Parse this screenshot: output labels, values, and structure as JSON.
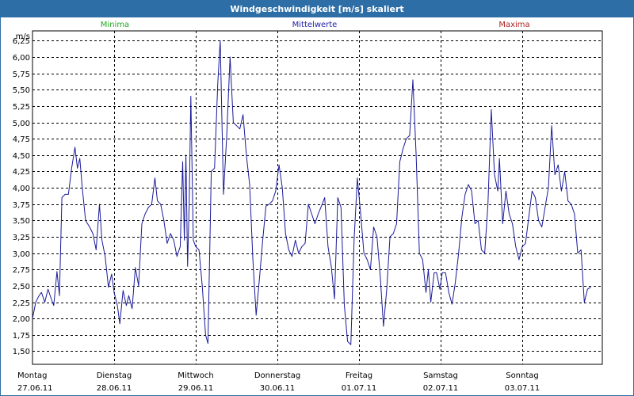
{
  "window": {
    "title": "Windgeschwindigkeit [m/s] skaliert"
  },
  "legend": [
    {
      "label": "Minima",
      "color": "#22aa22"
    },
    {
      "label": "Mittelwerte",
      "color": "#2222aa"
    },
    {
      "label": "Maxima",
      "color": "#aa2222"
    }
  ],
  "chart_data": {
    "type": "line",
    "title": "Windgeschwindigkeit [m/s] skaliert",
    "ylabel": "m/s",
    "xlabel": "",
    "ylim": [
      1.3,
      6.4
    ],
    "yticks": [
      "1,50",
      "1,75",
      "2,00",
      "2,25",
      "2,50",
      "2,75",
      "3,00",
      "3,25",
      "3,50",
      "3,75",
      "4,00",
      "4,25",
      "4,50",
      "4,75",
      "5,00",
      "5,25",
      "5,50",
      "5,75",
      "6,00",
      "6,25"
    ],
    "ytick_values": [
      1.5,
      1.75,
      2.0,
      2.25,
      2.5,
      2.75,
      3.0,
      3.25,
      3.5,
      3.75,
      4.0,
      4.25,
      4.5,
      4.75,
      5.0,
      5.25,
      5.5,
      5.75,
      6.0,
      6.25
    ],
    "xlim": [
      0,
      7
    ],
    "categories": [
      {
        "day": "Montag",
        "date": "27.06.11"
      },
      {
        "day": "Dienstag",
        "date": "28.06.11"
      },
      {
        "day": "Mittwoch",
        "date": "29.06.11"
      },
      {
        "day": "Donnerstag",
        "date": "30.06.11"
      },
      {
        "day": "Freitag",
        "date": "01.07.11"
      },
      {
        "day": "Samstag",
        "date": "02.07.11"
      },
      {
        "day": "Sonntag",
        "date": "03.07.11"
      }
    ],
    "grid": true,
    "series": [
      {
        "name": "Mittelwerte",
        "color": "#1a1a9a",
        "points": [
          [
            0.0,
            2.0
          ],
          [
            0.04,
            2.25
          ],
          [
            0.08,
            2.35
          ],
          [
            0.11,
            2.4
          ],
          [
            0.15,
            2.25
          ],
          [
            0.19,
            2.45
          ],
          [
            0.23,
            2.3
          ],
          [
            0.26,
            2.2
          ],
          [
            0.3,
            2.72
          ],
          [
            0.33,
            2.35
          ],
          [
            0.36,
            3.85
          ],
          [
            0.4,
            3.9
          ],
          [
            0.44,
            3.9
          ],
          [
            0.48,
            4.3
          ],
          [
            0.52,
            4.62
          ],
          [
            0.55,
            4.3
          ],
          [
            0.58,
            4.45
          ],
          [
            0.61,
            4.0
          ],
          [
            0.65,
            3.5
          ],
          [
            0.7,
            3.4
          ],
          [
            0.74,
            3.3
          ],
          [
            0.78,
            3.05
          ],
          [
            0.82,
            3.75
          ],
          [
            0.85,
            3.2
          ],
          [
            0.89,
            2.95
          ],
          [
            0.93,
            2.48
          ],
          [
            0.97,
            2.68
          ],
          [
            1.0,
            2.4
          ],
          [
            1.04,
            2.2
          ],
          [
            1.07,
            1.92
          ],
          [
            1.11,
            2.43
          ],
          [
            1.15,
            2.2
          ],
          [
            1.18,
            2.35
          ],
          [
            1.22,
            2.15
          ],
          [
            1.26,
            2.78
          ],
          [
            1.3,
            2.5
          ],
          [
            1.34,
            3.45
          ],
          [
            1.38,
            3.6
          ],
          [
            1.42,
            3.7
          ],
          [
            1.46,
            3.75
          ],
          [
            1.5,
            4.15
          ],
          [
            1.53,
            3.8
          ],
          [
            1.57,
            3.75
          ],
          [
            1.61,
            3.5
          ],
          [
            1.65,
            3.15
          ],
          [
            1.69,
            3.3
          ],
          [
            1.73,
            3.2
          ],
          [
            1.77,
            2.95
          ],
          [
            1.81,
            3.1
          ],
          [
            1.84,
            4.4
          ],
          [
            1.86,
            3.2
          ],
          [
            1.88,
            4.5
          ],
          [
            1.9,
            2.8
          ],
          [
            1.92,
            3.8
          ],
          [
            1.94,
            5.4
          ],
          [
            1.97,
            3.2
          ],
          [
            2.0,
            3.1
          ],
          [
            2.04,
            3.05
          ],
          [
            2.08,
            2.5
          ],
          [
            2.12,
            1.75
          ],
          [
            2.15,
            1.62
          ],
          [
            2.19,
            4.25
          ],
          [
            2.23,
            4.3
          ],
          [
            2.27,
            5.6
          ],
          [
            2.3,
            6.25
          ],
          [
            2.34,
            3.9
          ],
          [
            2.38,
            4.8
          ],
          [
            2.42,
            6.0
          ],
          [
            2.46,
            5.0
          ],
          [
            2.5,
            4.95
          ],
          [
            2.54,
            4.9
          ],
          [
            2.58,
            5.12
          ],
          [
            2.62,
            4.5
          ],
          [
            2.66,
            4.05
          ],
          [
            2.7,
            2.9
          ],
          [
            2.74,
            2.05
          ],
          [
            2.78,
            2.6
          ],
          [
            2.82,
            3.2
          ],
          [
            2.86,
            3.72
          ],
          [
            2.9,
            3.75
          ],
          [
            2.94,
            3.8
          ],
          [
            2.98,
            3.95
          ],
          [
            3.02,
            4.35
          ],
          [
            3.06,
            4.0
          ],
          [
            3.1,
            3.3
          ],
          [
            3.14,
            3.05
          ],
          [
            3.18,
            2.95
          ],
          [
            3.22,
            3.2
          ],
          [
            3.26,
            3.0
          ],
          [
            3.3,
            3.1
          ],
          [
            3.34,
            3.15
          ],
          [
            3.38,
            3.75
          ],
          [
            3.42,
            3.6
          ],
          [
            3.46,
            3.45
          ],
          [
            3.5,
            3.6
          ],
          [
            3.54,
            3.72
          ],
          [
            3.58,
            3.85
          ],
          [
            3.62,
            3.1
          ],
          [
            3.66,
            2.8
          ],
          [
            3.7,
            2.3
          ],
          [
            3.74,
            3.85
          ],
          [
            3.78,
            3.7
          ],
          [
            3.82,
            2.2
          ],
          [
            3.86,
            1.65
          ],
          [
            3.9,
            1.6
          ],
          [
            3.94,
            3.2
          ],
          [
            3.98,
            4.15
          ],
          [
            4.02,
            3.6
          ],
          [
            4.06,
            3.0
          ],
          [
            4.1,
            2.9
          ],
          [
            4.14,
            2.75
          ],
          [
            4.18,
            3.4
          ],
          [
            4.22,
            3.25
          ],
          [
            4.26,
            2.65
          ],
          [
            4.3,
            1.88
          ],
          [
            4.34,
            2.45
          ],
          [
            4.38,
            3.25
          ],
          [
            4.42,
            3.3
          ],
          [
            4.46,
            3.45
          ],
          [
            4.5,
            4.4
          ],
          [
            4.54,
            4.6
          ],
          [
            4.58,
            4.75
          ],
          [
            4.62,
            4.8
          ],
          [
            4.66,
            5.65
          ],
          [
            4.7,
            4.5
          ],
          [
            4.74,
            3.0
          ],
          [
            4.78,
            2.9
          ],
          [
            4.82,
            2.4
          ],
          [
            4.85,
            2.75
          ],
          [
            4.88,
            2.25
          ],
          [
            4.92,
            2.7
          ],
          [
            4.95,
            2.7
          ],
          [
            4.99,
            2.45
          ],
          [
            5.02,
            2.7
          ],
          [
            5.06,
            2.7
          ],
          [
            5.1,
            2.4
          ],
          [
            5.14,
            2.22
          ],
          [
            5.18,
            2.55
          ],
          [
            5.22,
            3.0
          ],
          [
            5.26,
            3.55
          ],
          [
            5.3,
            3.9
          ],
          [
            5.34,
            4.05
          ],
          [
            5.38,
            3.95
          ],
          [
            5.42,
            3.45
          ],
          [
            5.46,
            3.5
          ],
          [
            5.5,
            3.05
          ],
          [
            5.54,
            3.0
          ],
          [
            5.58,
            3.75
          ],
          [
            5.62,
            5.2
          ],
          [
            5.66,
            4.2
          ],
          [
            5.7,
            3.95
          ],
          [
            5.72,
            4.45
          ],
          [
            5.76,
            3.45
          ],
          [
            5.8,
            3.95
          ],
          [
            5.84,
            3.6
          ],
          [
            5.88,
            3.45
          ],
          [
            5.92,
            3.1
          ],
          [
            5.96,
            2.9
          ],
          [
            6.0,
            3.1
          ],
          [
            6.04,
            3.15
          ],
          [
            6.08,
            3.55
          ],
          [
            6.12,
            3.95
          ],
          [
            6.16,
            3.85
          ],
          [
            6.2,
            3.5
          ],
          [
            6.24,
            3.4
          ],
          [
            6.28,
            3.7
          ],
          [
            6.32,
            4.0
          ],
          [
            6.36,
            4.95
          ],
          [
            6.4,
            4.2
          ],
          [
            6.44,
            4.35
          ],
          [
            6.48,
            3.95
          ],
          [
            6.52,
            4.25
          ],
          [
            6.56,
            3.8
          ],
          [
            6.6,
            3.75
          ],
          [
            6.64,
            3.6
          ],
          [
            6.68,
            3.0
          ],
          [
            6.72,
            3.05
          ],
          [
            6.76,
            2.25
          ],
          [
            6.8,
            2.45
          ],
          [
            6.84,
            2.48
          ]
        ]
      }
    ]
  }
}
